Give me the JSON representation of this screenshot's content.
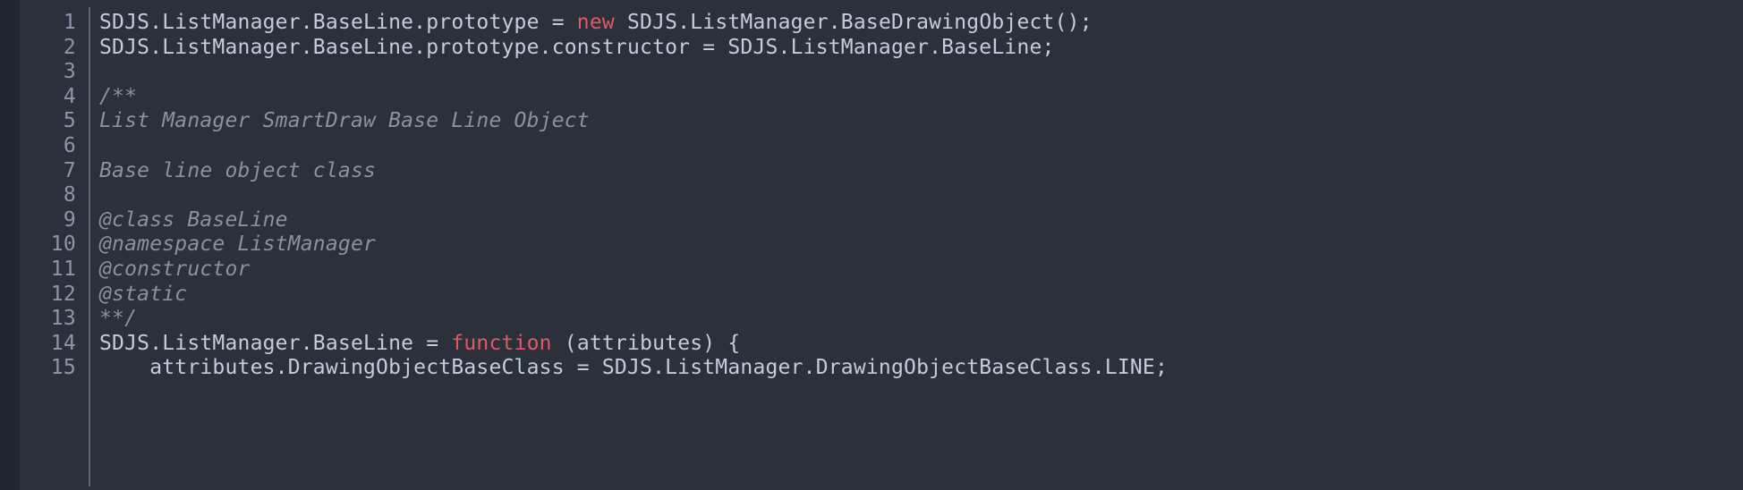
{
  "editor": {
    "theme_name": "dark",
    "colors": {
      "background": "#2b303b",
      "edge_strip": "#22262f",
      "gutter_text": "#8d96a8",
      "gutter_rule": "#5b6373",
      "code_text": "#c6ccd9",
      "comment_text": "#8c919c",
      "keyword": "#e0596a"
    },
    "gutter": {
      "line_numbers": [
        "1",
        "2",
        "3",
        "4",
        "5",
        "6",
        "7",
        "8",
        "9",
        "10",
        "11",
        "12",
        "13",
        "14",
        "15"
      ]
    },
    "lines": [
      {
        "number": "1",
        "type": "code",
        "text": "SDJS.ListManager.BaseLine.prototype = new SDJS.ListManager.BaseDrawingObject();",
        "segments": [
          {
            "text": "SDJS.ListManager.BaseLine.prototype = ",
            "kind": "plain"
          },
          {
            "text": "new",
            "kind": "keyword"
          },
          {
            "text": " SDJS.ListManager.BaseDrawingObject();",
            "kind": "plain"
          }
        ]
      },
      {
        "number": "2",
        "type": "code",
        "text": "SDJS.ListManager.BaseLine.prototype.constructor = SDJS.ListManager.BaseLine;",
        "segments": [
          {
            "text": "SDJS.ListManager.BaseLine.prototype.constructor = SDJS.ListManager.BaseLine;",
            "kind": "plain"
          }
        ]
      },
      {
        "number": "3",
        "type": "blank",
        "text": "",
        "segments": [
          {
            "text": "",
            "kind": "plain"
          }
        ]
      },
      {
        "number": "4",
        "type": "comment",
        "text": "/**",
        "segments": [
          {
            "text": "/**",
            "kind": "comment"
          }
        ]
      },
      {
        "number": "5",
        "type": "comment",
        "text": "List Manager SmartDraw Base Line Object",
        "segments": [
          {
            "text": "List Manager SmartDraw Base Line Object",
            "kind": "comment"
          }
        ]
      },
      {
        "number": "6",
        "type": "comment",
        "text": "",
        "segments": [
          {
            "text": "",
            "kind": "comment"
          }
        ]
      },
      {
        "number": "7",
        "type": "comment",
        "text": "Base line object class",
        "segments": [
          {
            "text": "Base line object class",
            "kind": "comment"
          }
        ]
      },
      {
        "number": "8",
        "type": "comment",
        "text": "",
        "segments": [
          {
            "text": "",
            "kind": "comment"
          }
        ]
      },
      {
        "number": "9",
        "type": "comment",
        "text": "@class BaseLine",
        "segments": [
          {
            "text": "@class BaseLine",
            "kind": "comment"
          }
        ]
      },
      {
        "number": "10",
        "type": "comment",
        "text": "@namespace ListManager",
        "segments": [
          {
            "text": "@namespace ListManager",
            "kind": "comment"
          }
        ]
      },
      {
        "number": "11",
        "type": "comment",
        "text": "@constructor",
        "segments": [
          {
            "text": "@constructor",
            "kind": "comment"
          }
        ]
      },
      {
        "number": "12",
        "type": "comment",
        "text": "@static",
        "segments": [
          {
            "text": "@static",
            "kind": "comment"
          }
        ]
      },
      {
        "number": "13",
        "type": "comment",
        "text": "**/",
        "segments": [
          {
            "text": "**/",
            "kind": "comment"
          }
        ]
      },
      {
        "number": "14",
        "type": "code",
        "text": "SDJS.ListManager.BaseLine = function (attributes) {",
        "segments": [
          {
            "text": "SDJS.ListManager.BaseLine = ",
            "kind": "plain"
          },
          {
            "text": "function",
            "kind": "keyword"
          },
          {
            "text": " (attributes) {",
            "kind": "plain"
          }
        ]
      },
      {
        "number": "15",
        "type": "code",
        "text": "    attributes.DrawingObjectBaseClass = SDJS.ListManager.DrawingObjectBaseClass.LINE;",
        "segments": [
          {
            "text": "    attributes.DrawingObjectBaseClass = SDJS.ListManager.DrawingObjectBaseClass.LINE;",
            "kind": "plain"
          }
        ]
      }
    ]
  }
}
